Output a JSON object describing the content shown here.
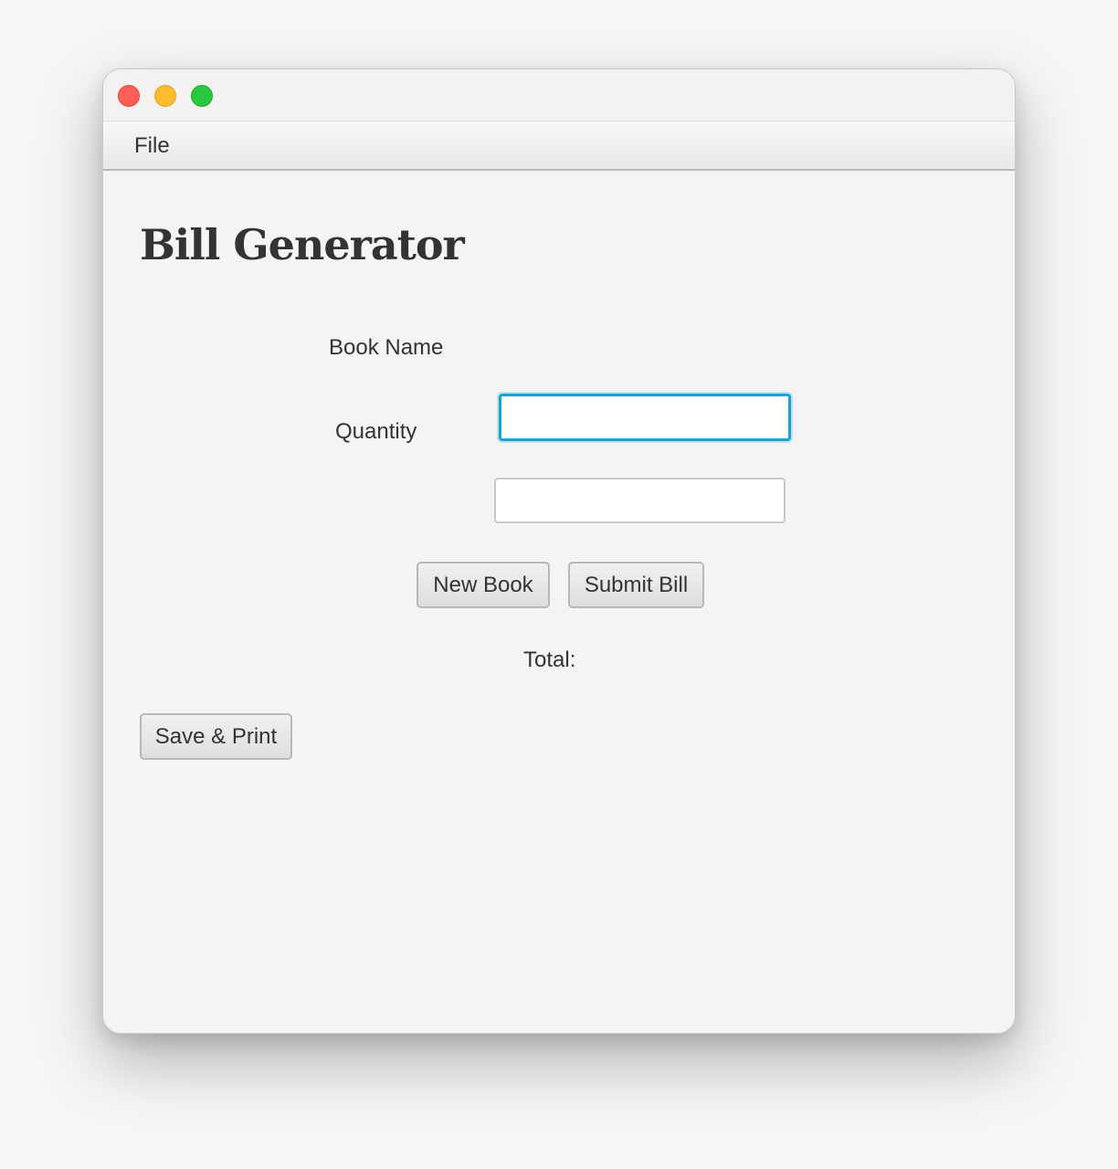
{
  "menubar": {
    "items": [
      {
        "label": "File"
      }
    ]
  },
  "main": {
    "title": "Bill Generator",
    "form": {
      "book_name_label": "Book Name",
      "book_name_value": "",
      "quantity_label": "Quantity",
      "quantity_value": ""
    },
    "buttons": {
      "new_book": "New Book",
      "submit_bill": "Submit Bill",
      "save_print": "Save & Print"
    },
    "total_label": "Total:"
  },
  "colors": {
    "focus_ring": "#1aa3d1",
    "close": "#fe5f57",
    "minimize": "#febc2e",
    "maximize": "#28c840"
  }
}
